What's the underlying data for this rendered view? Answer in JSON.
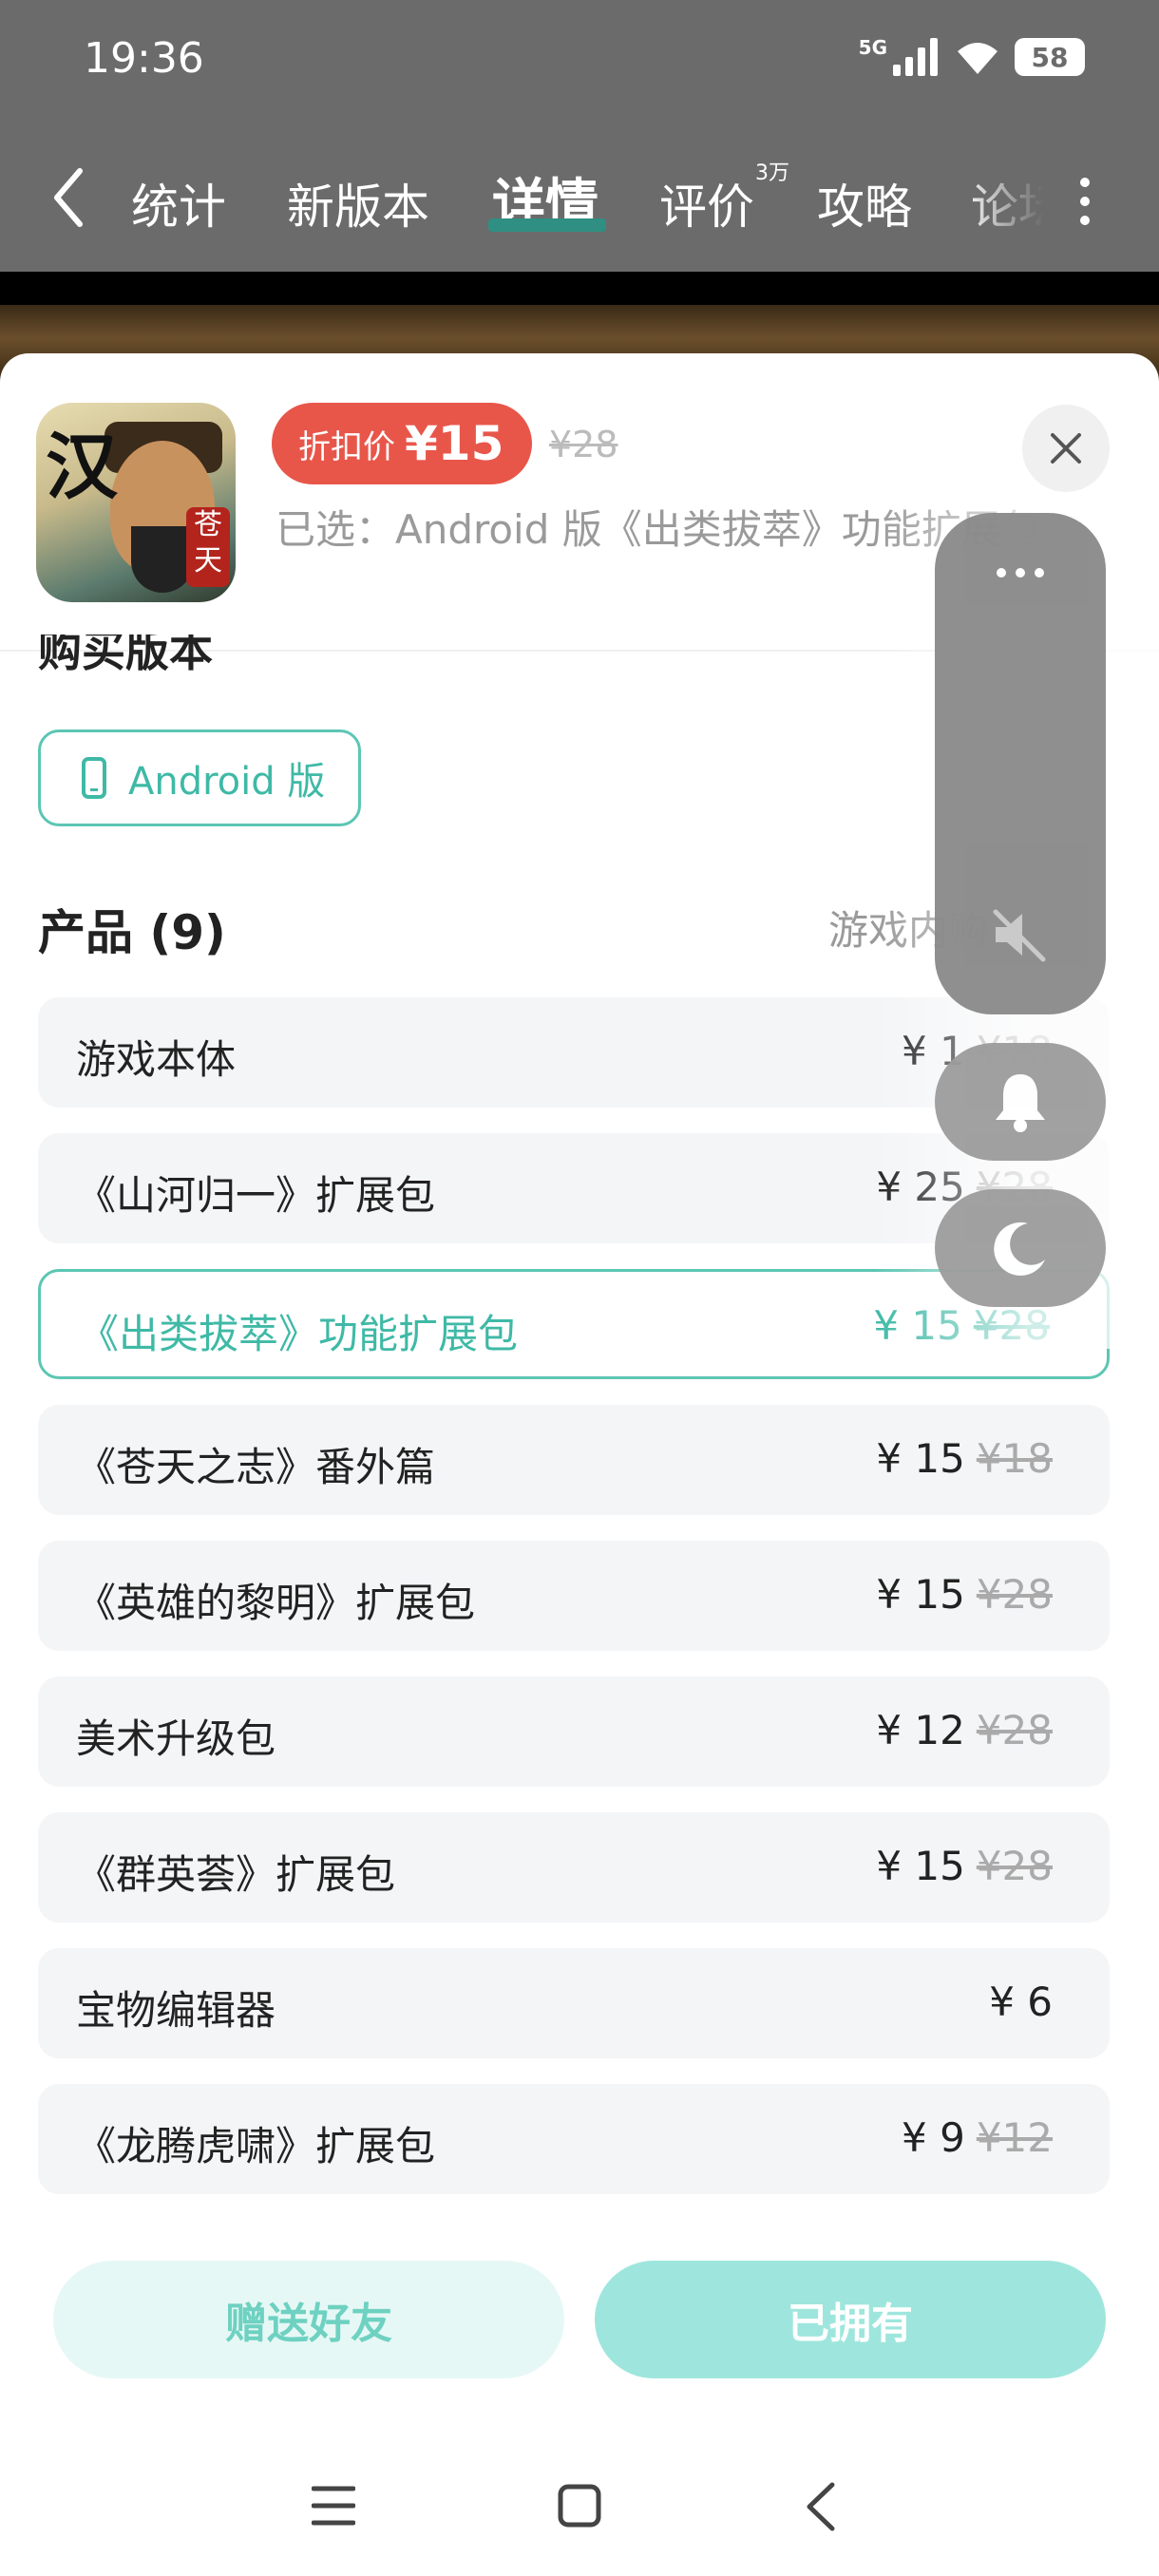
{
  "status_bar": {
    "time": "19:36",
    "network": "5G",
    "battery": "58"
  },
  "tabs": [
    {
      "label": "统计"
    },
    {
      "label": "新版本"
    },
    {
      "label": "详情",
      "active": true
    },
    {
      "label": "评价",
      "badge": "3万"
    },
    {
      "label": "攻略"
    },
    {
      "label": "论坛"
    }
  ],
  "app_icon": {
    "title_char": "汉",
    "seal_text": "苍天"
  },
  "price": {
    "label": "折扣价",
    "current": "¥15",
    "original": "¥28"
  },
  "selected_text": "已选：Android 版《出类拔萃》功能扩展包",
  "buy_version_heading": "购买版本",
  "platform_chip": "Android 版",
  "products_heading": "产品 (9)",
  "ingame_link": "游戏内购",
  "products": [
    {
      "name": "游戏本体",
      "price": "¥ 1",
      "original": "¥18",
      "selected": false
    },
    {
      "name": "《山河归一》扩展包",
      "price": "¥ 25",
      "original": "¥28",
      "selected": false
    },
    {
      "name": "《出类拔萃》功能扩展包",
      "price": "¥ 15",
      "original": "¥28",
      "selected": true
    },
    {
      "name": "《苍天之志》番外篇",
      "price": "¥ 15",
      "original": "¥18",
      "selected": false
    },
    {
      "name": "《英雄的黎明》扩展包",
      "price": "¥ 15",
      "original": "¥28",
      "selected": false
    },
    {
      "name": "美术升级包",
      "price": "¥ 12",
      "original": "¥28",
      "selected": false
    },
    {
      "name": "《群英荟》扩展包",
      "price": "¥ 15",
      "original": "¥28",
      "selected": false
    },
    {
      "name": "宝物编辑器",
      "price": "¥ 6",
      "original": "",
      "selected": false
    },
    {
      "name": "《龙腾虎啸》扩展包",
      "price": "¥ 9",
      "original": "¥12",
      "selected": false
    }
  ],
  "buttons": {
    "gift": "赠送好友",
    "owned": "已拥有"
  },
  "colors": {
    "accent": "#3fb9a6",
    "price_pill": "#e8564a",
    "active_tab_underline": "#2f8f82"
  }
}
